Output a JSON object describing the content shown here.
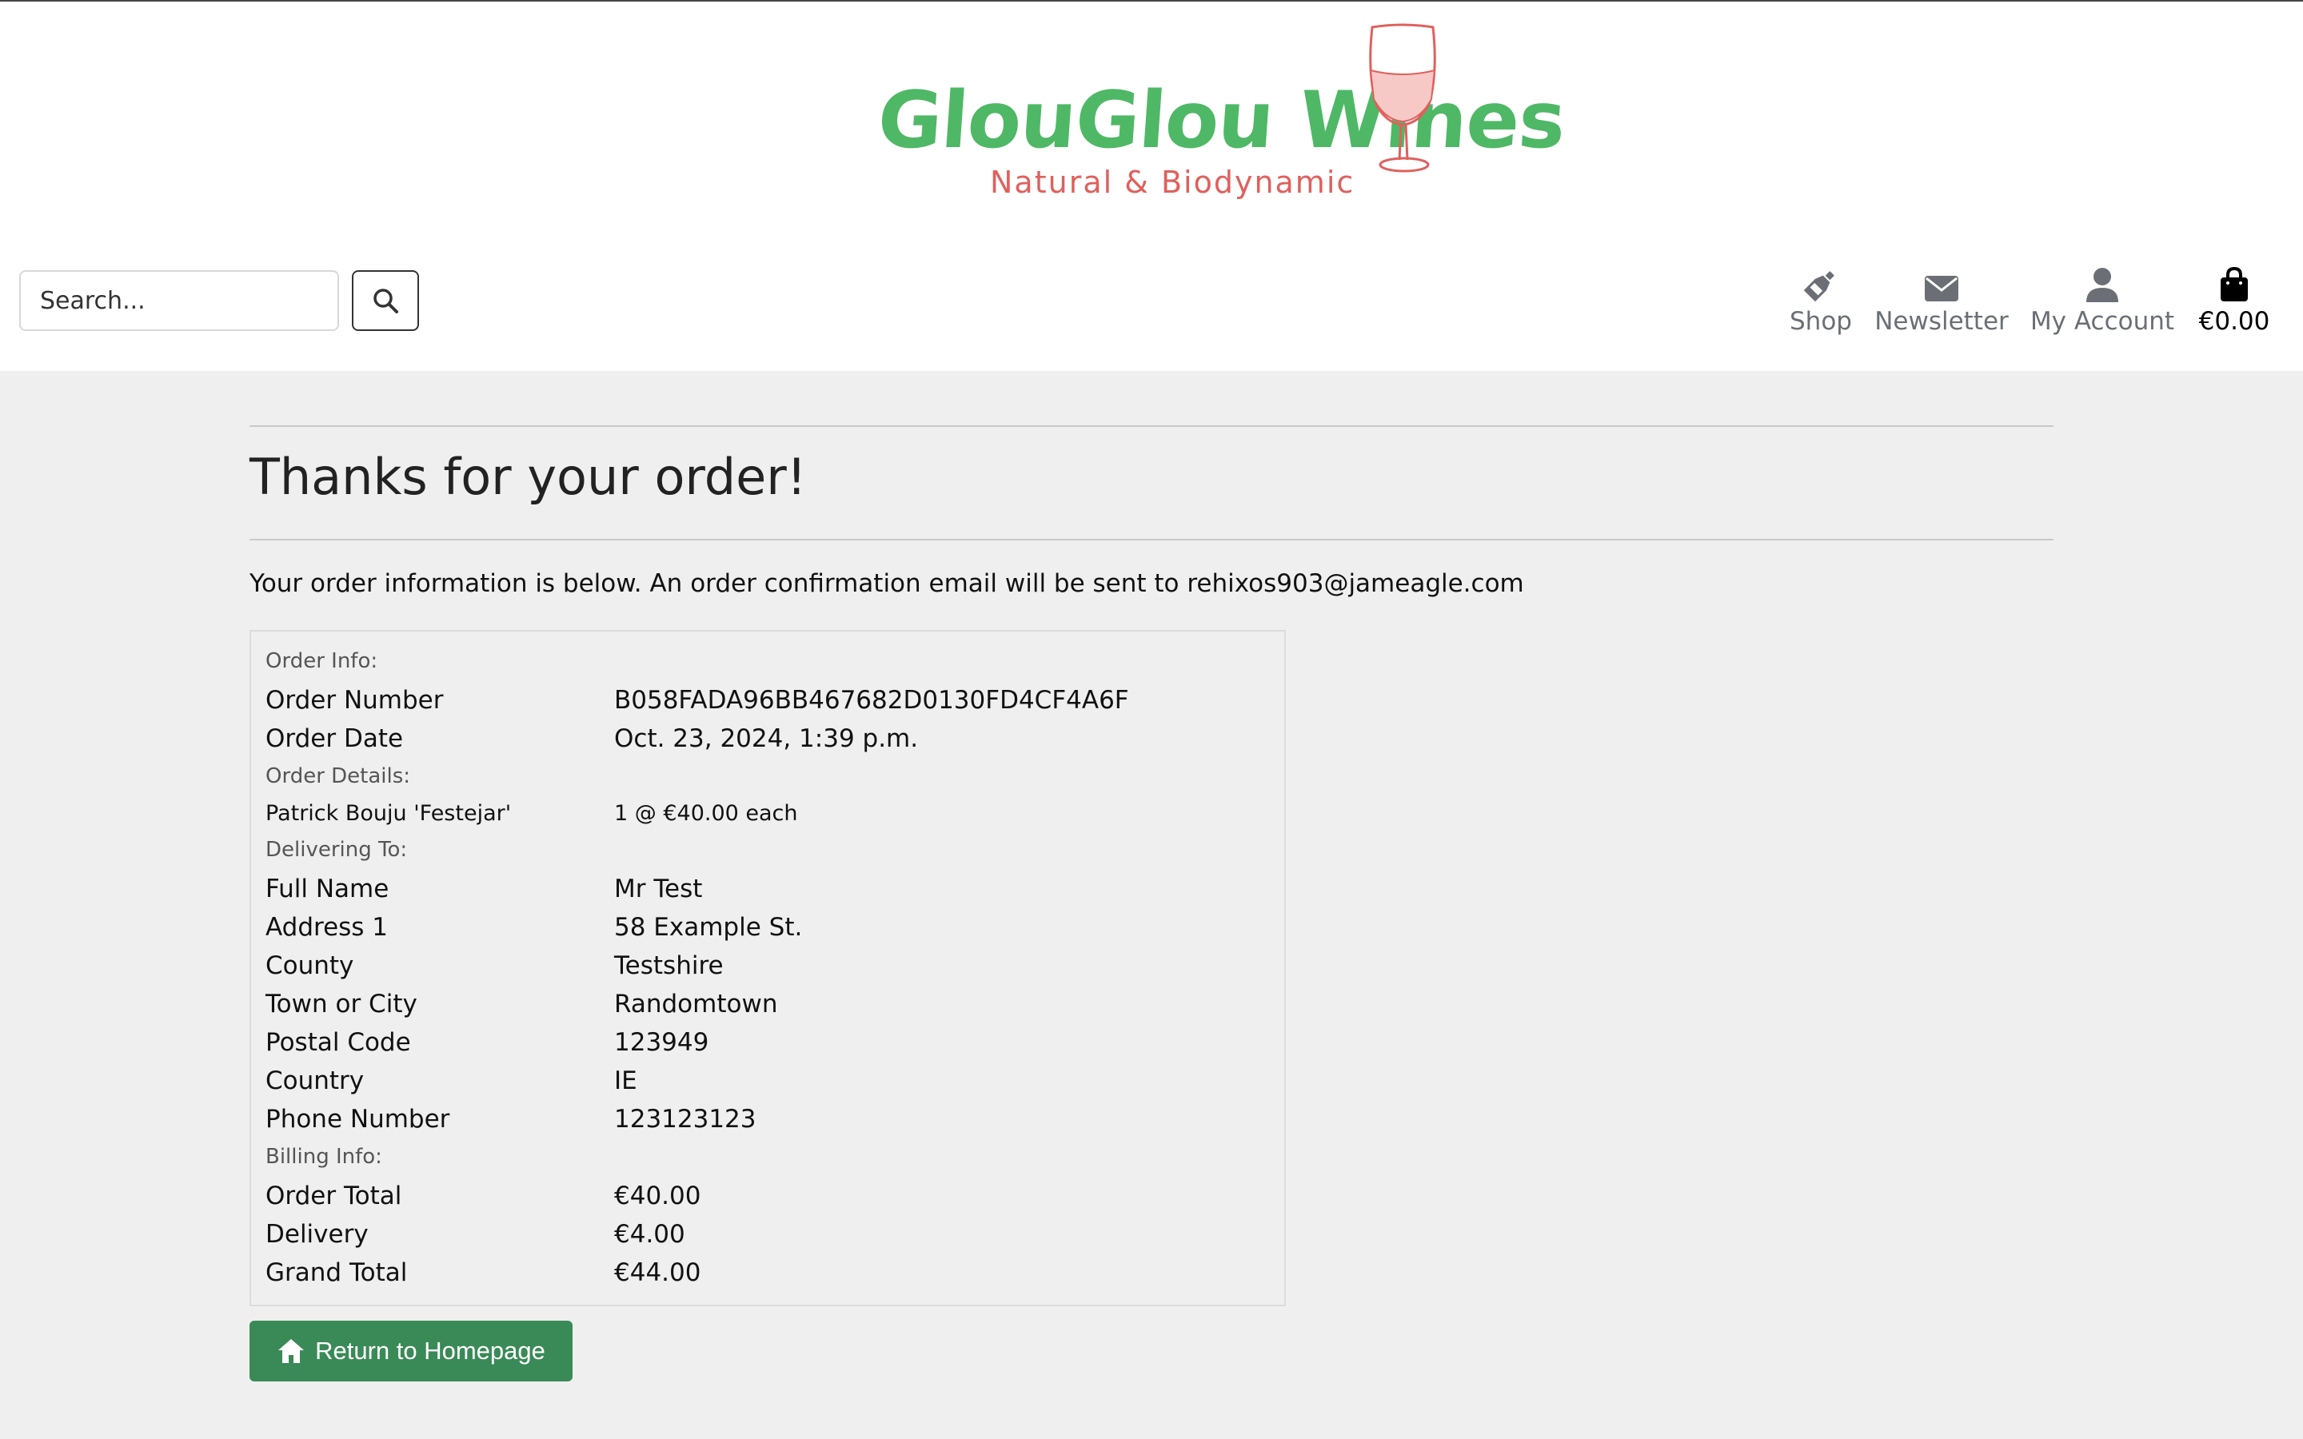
{
  "brand": {
    "name": "GlouGlou Wines",
    "tagline": "Natural & Biodynamic",
    "title_color": "#4fb866",
    "tagline_color": "#e0605d"
  },
  "search": {
    "placeholder": "Search...",
    "button_icon": "search-icon"
  },
  "nav": {
    "shop": {
      "label": "Shop",
      "icon": "wine-bottle-icon"
    },
    "newsletter": {
      "label": "Newsletter",
      "icon": "envelope-icon"
    },
    "account": {
      "label": "My Account",
      "icon": "user-icon"
    },
    "bag": {
      "label": "€0.00",
      "icon": "shopping-bag-icon"
    }
  },
  "page": {
    "title": "Thanks for your order!",
    "intro": "Your order information is below. An order confirmation email will be sent to rehixos903@jameagle.com"
  },
  "order": {
    "order_info_heading": "Order Info:",
    "order_number_label": "Order Number",
    "order_number": "B058FADA96BB467682D0130FD4CF4A6F",
    "order_date_label": "Order Date",
    "order_date": "Oct. 23, 2024, 1:39 p.m.",
    "details_heading": "Order Details:",
    "items": [
      {
        "name": "Patrick Bouju 'Festejar'",
        "qty_price": "1 @ €40.00 each"
      }
    ],
    "delivering_heading": "Delivering To:",
    "delivery": [
      {
        "label": "Full Name",
        "value": "Mr Test"
      },
      {
        "label": "Address 1",
        "value": "58 Example St."
      },
      {
        "label": "County",
        "value": "Testshire"
      },
      {
        "label": "Town or City",
        "value": "Randomtown"
      },
      {
        "label": "Postal Code",
        "value": "123949"
      },
      {
        "label": "Country",
        "value": "IE"
      },
      {
        "label": "Phone Number",
        "value": "123123123"
      }
    ],
    "billing_heading": "Billing Info:",
    "billing": [
      {
        "label": "Order Total",
        "value": "€40.00"
      },
      {
        "label": "Delivery",
        "value": "€4.00"
      },
      {
        "label": "Grand Total",
        "value": "€44.00"
      }
    ]
  },
  "actions": {
    "home_label": "Return to Homepage",
    "home_icon": "home-icon",
    "button_color": "#3a8a57"
  }
}
